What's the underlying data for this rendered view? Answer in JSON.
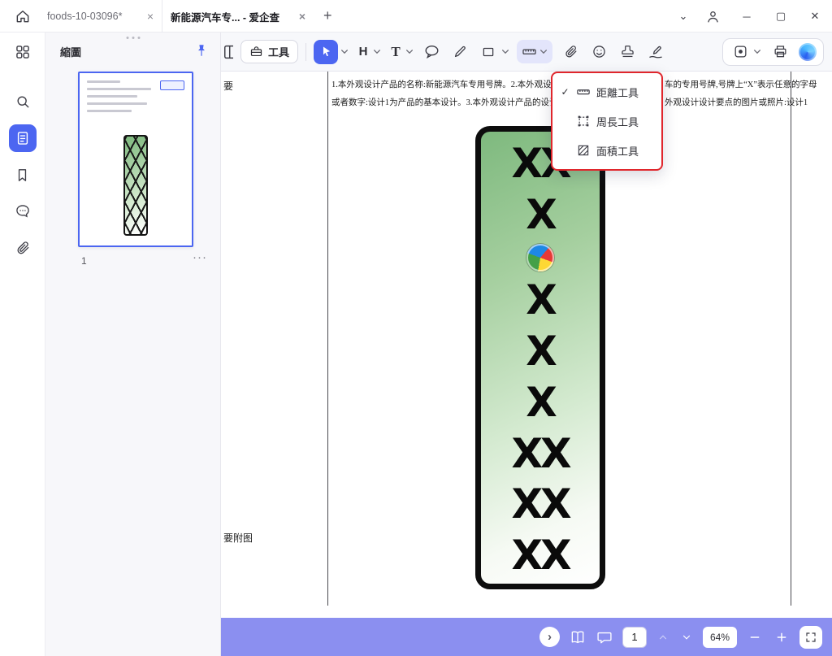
{
  "window": {
    "tabs": [
      {
        "label": "foods-10-03096*",
        "active": false
      },
      {
        "label": "新能源汽车专... - 爱企查",
        "active": true
      }
    ]
  },
  "glyphs": {
    "tab_close": "×",
    "new_tab": "+",
    "titlebar_chevron": "⌄",
    "minimize": "─",
    "maximize": "▢",
    "close": "✕",
    "check": "✓",
    "more_dots": "···",
    "expand_arrow": "›"
  },
  "sidebar": {
    "active_item": "pages"
  },
  "thumb_panel": {
    "title": "縮圖",
    "page_number": "1"
  },
  "toolbar": {
    "tools_label": "工具",
    "h_tool": "H",
    "t_tool": "T"
  },
  "measure_menu": {
    "items": [
      {
        "label": "距離工具",
        "checked": true
      },
      {
        "label": "周長工具",
        "checked": false
      },
      {
        "label": "面積工具",
        "checked": false
      }
    ]
  },
  "document": {
    "margin_label_top": "要",
    "margin_label_bottom": "要附图",
    "text_line1_left": "1.本外观设计产品的名称:新能源汽车专用号牌。2.本外观设计产品",
    "text_line1_right": "车的专用号牌,号牌上“X”表示任意的字母",
    "text_line2_left": "或者数字:设计1为产品的基本设计。3.本外观设计产品的设计要点",
    "text_line2_right": "外观设计设计要点的图片或照片:设计1",
    "plate": {
      "top_rows": [
        "XX",
        "X"
      ],
      "bottom_rows": [
        "X",
        "X",
        "X",
        "XX",
        "XX",
        "XX"
      ]
    }
  },
  "bottom_bar": {
    "page_value": "1",
    "zoom": "64%"
  },
  "colors": {
    "accent_blue": "#4c66f1",
    "toolbar_active_bg": "#e3e5fb",
    "bottom_bar_purple": "#8b8ff0",
    "annotation_red": "#e0262c",
    "plate_green": "#7eb97e"
  }
}
